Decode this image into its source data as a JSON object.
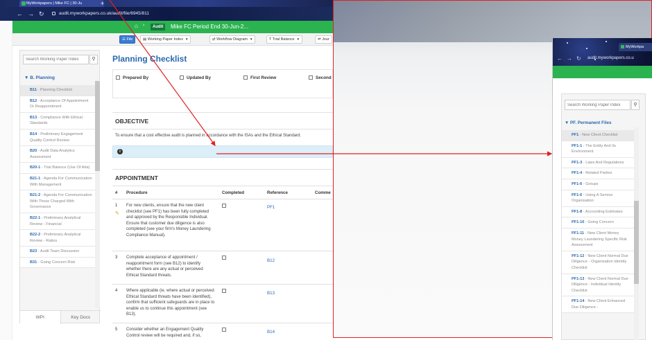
{
  "browser": {
    "tab_title": "MyWorkpapers | Mike FC | 30-Ju",
    "new_tab": "+",
    "url": "audit.myworkpapers.co.uk/audit/file/6945/811",
    "icons": [
      "back-arrow-icon",
      "forward-arrow-icon",
      "reload-icon",
      "lock-icon"
    ]
  },
  "header": {
    "badge": "Audit",
    "client": "Mike FC  Period End 30-Jun-2..."
  },
  "toolbar": {
    "file": "File",
    "wp_index": "Working Paper Index",
    "workflow": "Workflow Diagram",
    "trial_balance": "Trial Balance",
    "journals": "Jour"
  },
  "sidebar": {
    "search_placeholder": "Search Working Paper Index",
    "section": "B. Planning",
    "items": [
      {
        "code": "B11",
        "label": " - Planning Checklist"
      },
      {
        "code": "B12",
        "label": " - Acceptance Of Appointment Or Reappointment"
      },
      {
        "code": "B13",
        "label": " - Compliance With Ethical Standards"
      },
      {
        "code": "B14",
        "label": " - Preliminary Engagement Quality Control Review"
      },
      {
        "code": "B20",
        "label": " - Audit Data Analytics Assessment"
      },
      {
        "code": "B20-1",
        "label": " - Trial Balance (Use Of Ada)"
      },
      {
        "code": "B21-1",
        "label": " - Agenda For Communication With Management"
      },
      {
        "code": "B21-2",
        "label": " - Agenda For Communication With Those Charged With Governance"
      },
      {
        "code": "B22-1",
        "label": " - Preliminary Analytical Review - Financial"
      },
      {
        "code": "B22-2",
        "label": " - Preliminary Analytical Review - Ratios"
      },
      {
        "code": "B23",
        "label": " - Audit Team Discussion"
      },
      {
        "code": "B31",
        "label": " - Going Concern Risk"
      }
    ],
    "tabs": [
      "WPI",
      "Key Docs"
    ]
  },
  "main": {
    "title": "Planning Checklist",
    "signoff": [
      "Prepared By",
      "Updated By",
      "First Review",
      "Second"
    ],
    "objective_title": "OBJECTIVE",
    "objective_text": "To ensure that a cost effective audit is planned in accordance with the ISAs and the Ethical Standard.",
    "appointment_title": "APPOINTMENT",
    "columns": [
      "#",
      "Procedure",
      "Completed",
      "Reference",
      "Comme"
    ],
    "rows": [
      {
        "num": "1",
        "procedure": "For new clients, ensure that the new client checklist (see PF1) has been fully completed and approved by the Responsible Individual. Ensure that customer due diligence is also completed (see your firm's Money Laundering Compliance Manual).",
        "ref": "PF1"
      },
      {
        "num": "3",
        "procedure": "Complete acceptance of appointment / reappointment form (see B12) to identify whether there are any actual or perceived Ethical Standard threats.",
        "ref": "B12"
      },
      {
        "num": "4",
        "procedure": "Where applicable (ie. where actual or perceived Ethical Standard threats have been identified), confirm that sufficient safeguards are in place to enable us to continue this appointment (see B13).",
        "ref": "B13"
      },
      {
        "num": "5",
        "procedure": "Consider whether an Engagement Quality Control review will be required and, if so,",
        "ref": "B14"
      }
    ]
  },
  "window2": {
    "tab_title": "MyWorkpa",
    "url": "audit.myworkpapers.co.u",
    "search_placeholder": "Search Working Paper Index",
    "section": "PF. Permanent Files",
    "items": [
      {
        "code": "PF1",
        "label": " - New Client Checklist"
      },
      {
        "code": "PF1-1",
        "label": " - The Entity And Its Environment"
      },
      {
        "code": "PF1-3",
        "label": " - Laws And Regulations"
      },
      {
        "code": "PF1-4",
        "label": " - Related Parties"
      },
      {
        "code": "PF1-6",
        "label": " - Groups"
      },
      {
        "code": "PF1-6",
        "label": " - Using A Service Organisation"
      },
      {
        "code": "PF1-8",
        "label": " - Accounting Estimates"
      },
      {
        "code": "PF1-10",
        "label": " - Going Concern"
      },
      {
        "code": "PF1-11",
        "label": " - New Client Money Money Laundering Specific Risk Assessment"
      },
      {
        "code": "PF1-12",
        "label": " - New Client Normal Due Diligence - Organisation Identity Checklist"
      },
      {
        "code": "PF1-13",
        "label": " - New Client Normal Due Diligence - Individual Identity Checklist"
      },
      {
        "code": "PF1-14",
        "label": " - New Client Enhanced Due Diligence -"
      }
    ]
  },
  "colors": {
    "accent": "#2a68b0",
    "green": "#2bb34f",
    "annotation": "#e02020"
  }
}
